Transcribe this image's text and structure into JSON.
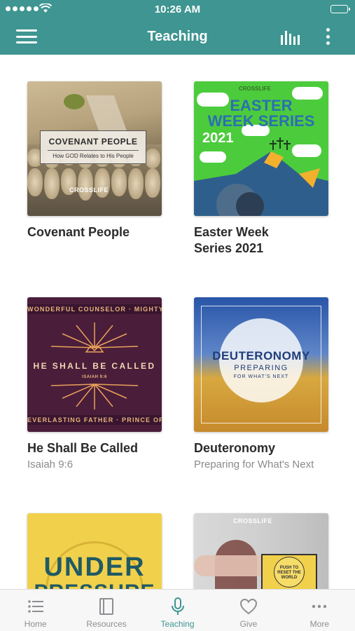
{
  "status_bar": {
    "time": "10:26 AM"
  },
  "header": {
    "title": "Teaching"
  },
  "cards": [
    {
      "title": "Covenant People",
      "subtitle": "",
      "art": {
        "plaque_title": "COVENANT PEOPLE",
        "plaque_sub": "How GOD Relates to His People",
        "brand": "CROSSLIFE"
      }
    },
    {
      "title": "Easter Week Series 2021",
      "subtitle": "",
      "art": {
        "brand": "CROSSLIFE",
        "line1": "EASTER",
        "line2": "WEEK SERIES",
        "line3": "2021"
      }
    },
    {
      "title": "He Shall Be Called",
      "subtitle": "Isaiah 9:6",
      "art": {
        "top_band": "WONDERFUL COUNSELOR · MIGHTY GOD",
        "big": "HE SHALL BE CALLED",
        "ref": "ISAIAH 9:6",
        "bottom_band": "EVERLASTING FATHER · PRINCE OF PEACE"
      }
    },
    {
      "title": "Deuteronomy",
      "subtitle": "Preparing for What's Next",
      "art": {
        "t1": "DEUTERONOMY",
        "t2": "PREPARING",
        "t3": "FOR WHAT'S NEXT"
      }
    },
    {
      "title": "",
      "subtitle": "",
      "art": {
        "word1": "UNDER",
        "word2": "PRESSURE"
      }
    },
    {
      "title": "",
      "subtitle": "",
      "art": {
        "brand": "CROSSLIFE",
        "sign": "PUSH TO RESET THE WORLD"
      }
    }
  ],
  "tabbar": {
    "items": [
      {
        "label": "Home",
        "icon": "list-icon",
        "active": false
      },
      {
        "label": "Resources",
        "icon": "book-icon",
        "active": false
      },
      {
        "label": "Teaching",
        "icon": "microphone-icon",
        "active": true
      },
      {
        "label": "Give",
        "icon": "heart-icon",
        "active": false
      },
      {
        "label": "More",
        "icon": "more-horizontal-icon",
        "active": false
      }
    ]
  },
  "colors": {
    "header": "#3e9591",
    "accent": "#3e9591",
    "tab_inactive": "#8e8e93"
  }
}
